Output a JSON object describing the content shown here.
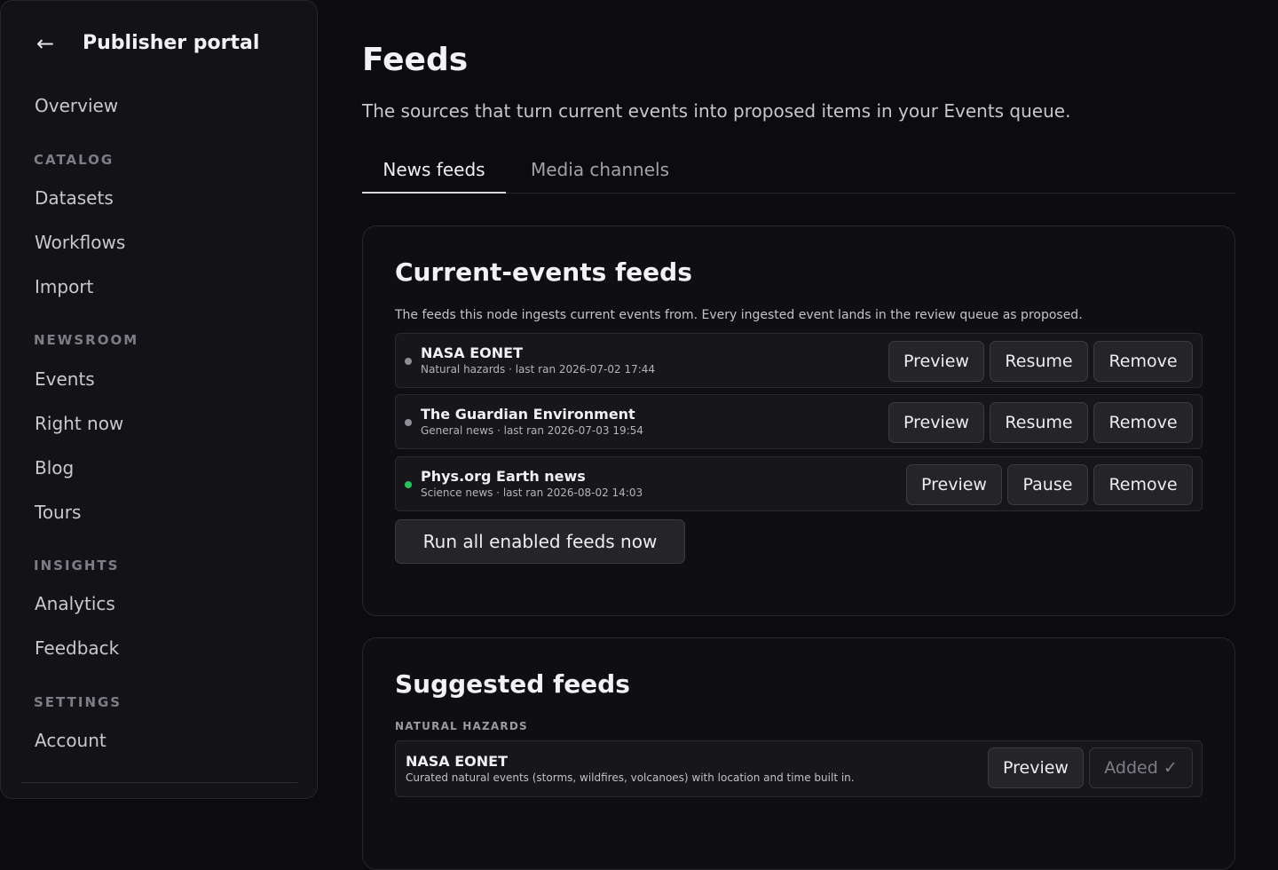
{
  "sidebar": {
    "back_icon": "arrow-left-icon",
    "title": "Publisher portal",
    "overview": "Overview",
    "sections": [
      {
        "label": "CATALOG",
        "items": [
          "Datasets",
          "Workflows",
          "Import"
        ]
      },
      {
        "label": "NEWSROOM",
        "items": [
          "Events",
          "Right now",
          "Blog",
          "Tours"
        ]
      },
      {
        "label": "INSIGHTS",
        "items": [
          "Analytics",
          "Feedback"
        ]
      },
      {
        "label": "SETTINGS",
        "items": [
          "Account"
        ]
      }
    ]
  },
  "header": {
    "title": "Feeds",
    "subtitle": "The sources that turn current events into proposed items in your Events queue."
  },
  "tabs": [
    {
      "label": "News feeds",
      "active": true
    },
    {
      "label": "Media channels",
      "active": false
    }
  ],
  "current_feeds": {
    "title": "Current-events feeds",
    "description": "The feeds this node ingests current events from. Every ingested event lands in the review queue as proposed.",
    "items": [
      {
        "name": "NASA EONET",
        "meta": "Natural hazards · last ran 2026-07-02 17:44",
        "status": "paused",
        "status_color": "#8e8e96",
        "preview": "Preview",
        "toggle": "Resume",
        "remove": "Remove"
      },
      {
        "name": "The Guardian Environment",
        "meta": "General news · last ran 2026-07-03 19:54",
        "status": "paused",
        "status_color": "#8e8e96",
        "preview": "Preview",
        "toggle": "Resume",
        "remove": "Remove"
      },
      {
        "name": "Phys.org Earth news",
        "meta": "Science news · last ran 2026-08-02 14:03",
        "status": "active",
        "status_color": "#22c55e",
        "preview": "Preview",
        "toggle": "Pause",
        "remove": "Remove"
      }
    ],
    "run_all": "Run all enabled feeds now"
  },
  "suggested": {
    "title": "Suggested feeds",
    "category": "NATURAL HAZARDS",
    "items": [
      {
        "name": "NASA EONET",
        "description": "Curated natural events (storms, wildfires, volcanoes) with location and time built in.",
        "preview": "Preview",
        "added": "Added ✓"
      }
    ]
  }
}
